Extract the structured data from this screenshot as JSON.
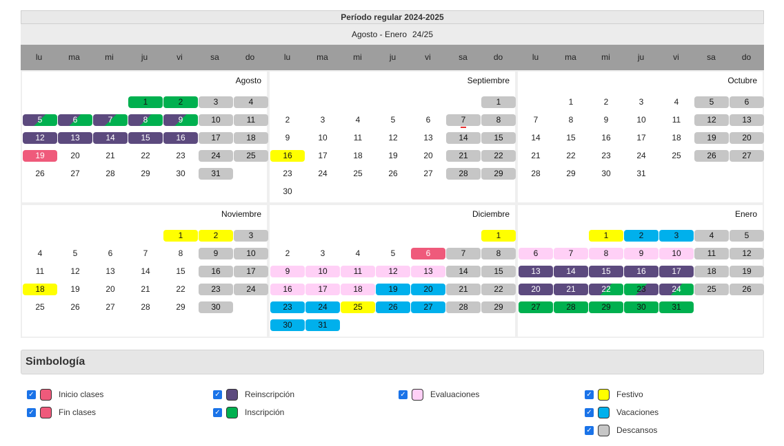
{
  "header": {
    "title": "Período regular 2024-2025",
    "subtitle": "Agosto - Enero",
    "period_code": "24/25"
  },
  "colors": {
    "inicio_fin": "#ef5a7b",
    "reinscripcion": "#5c4a7e",
    "inscripcion": "#00b04f",
    "evaluaciones": "#ffd0f6",
    "festivo": "#ffff00",
    "vacaciones": "#00b0ec",
    "descansos": "#c6c6c6"
  },
  "weekdays": [
    "lu",
    "ma",
    "mi",
    "ju",
    "vi",
    "sa",
    "do",
    "lu",
    "ma",
    "mi",
    "ju",
    "vi",
    "sa",
    "do",
    "lu",
    "ma",
    "mi",
    "ju",
    "vi",
    "sa",
    "do"
  ],
  "months": [
    {
      "name": "Agosto",
      "offset": 3,
      "days": 31,
      "today": 0,
      "marks": {
        "1": "inscripcion",
        "2": "inscripcion",
        "3": "descansos",
        "4": "descansos",
        "5": "reinscripcion+inscripcion",
        "6": "reinscripcion+inscripcion",
        "7": "reinscripcion+inscripcion",
        "8": "reinscripcion+inscripcion",
        "9": "reinscripcion+inscripcion",
        "10": "descansos",
        "11": "descansos",
        "12": "reinscripcion",
        "13": "reinscripcion",
        "14": "reinscripcion",
        "15": "reinscripcion",
        "16": "reinscripcion",
        "17": "descansos",
        "18": "descansos",
        "19": "inicio_fin",
        "24": "descansos",
        "25": "descansos",
        "31": "descansos"
      }
    },
    {
      "name": "Septiembre",
      "offset": 6,
      "days": 30,
      "today": 7,
      "marks": {
        "1": "descansos",
        "7": "descansos",
        "8": "descansos",
        "14": "descansos",
        "15": "descansos",
        "16": "festivo",
        "21": "descansos",
        "22": "descansos",
        "28": "descansos",
        "29": "descansos"
      }
    },
    {
      "name": "Octubre",
      "offset": 1,
      "days": 31,
      "today": 0,
      "marks": {
        "5": "descansos",
        "6": "descansos",
        "12": "descansos",
        "13": "descansos",
        "19": "descansos",
        "20": "descansos",
        "26": "descansos",
        "27": "descansos"
      }
    },
    {
      "name": "Noviembre",
      "offset": 4,
      "days": 30,
      "today": 0,
      "marks": {
        "1": "festivo",
        "2": "festivo",
        "3": "descansos",
        "9": "descansos",
        "10": "descansos",
        "16": "descansos",
        "17": "descansos",
        "18": "festivo",
        "23": "descansos",
        "24": "descansos",
        "30": "descansos"
      }
    },
    {
      "name": "Diciembre",
      "offset": 6,
      "days": 31,
      "today": 0,
      "marks": {
        "1": "festivo",
        "6": "inicio_fin",
        "7": "descansos",
        "8": "descansos",
        "9": "evaluaciones",
        "10": "evaluaciones",
        "11": "evaluaciones",
        "12": "evaluaciones",
        "13": "evaluaciones",
        "14": "descansos",
        "15": "descansos",
        "16": "evaluaciones",
        "17": "evaluaciones",
        "18": "evaluaciones",
        "19": "vacaciones",
        "20": "vacaciones",
        "21": "descansos",
        "22": "descansos",
        "23": "vacaciones",
        "24": "vacaciones",
        "25": "festivo",
        "26": "vacaciones",
        "27": "vacaciones",
        "28": "descansos",
        "29": "descansos",
        "30": "vacaciones",
        "31": "vacaciones"
      }
    },
    {
      "name": "Enero",
      "offset": 2,
      "days": 31,
      "today": 0,
      "marks": {
        "1": "festivo",
        "2": "vacaciones",
        "3": "vacaciones",
        "4": "descansos",
        "5": "descansos",
        "6": "evaluaciones",
        "7": "evaluaciones",
        "8": "evaluaciones",
        "9": "evaluaciones",
        "10": "evaluaciones",
        "11": "descansos",
        "12": "descansos",
        "13": "reinscripcion",
        "14": "reinscripcion",
        "15": "reinscripcion",
        "16": "reinscripcion",
        "17": "reinscripcion",
        "18": "descansos",
        "19": "descansos",
        "20": "reinscripcion",
        "21": "reinscripcion",
        "22": "reinscripcion+inscripcion",
        "23": "inscripcion+reinscripcion",
        "24": "reinscripcion+inscripcion",
        "25": "descansos",
        "26": "descansos",
        "27": "inscripcion",
        "28": "inscripcion",
        "29": "inscripcion",
        "30": "inscripcion",
        "31": "inscripcion"
      }
    }
  ],
  "legend": {
    "title": "Simbología",
    "items": [
      {
        "label": "Inicio clases",
        "color": "#ef5a7b",
        "checked": true
      },
      {
        "label": "Fin clases",
        "color": "#ef5a7b",
        "checked": true
      },
      {
        "label": "Reinscripción",
        "color": "#5c4a7e",
        "checked": true
      },
      {
        "label": "Inscripción",
        "color": "#00b04f",
        "checked": true
      },
      {
        "label": "Evaluaciones",
        "color": "#ffd0f6",
        "checked": true
      },
      {
        "label": "Festivo",
        "color": "#ffff00",
        "checked": true
      },
      {
        "label": "Vacaciones",
        "color": "#00b0ec",
        "checked": true
      },
      {
        "label": "Descansos",
        "color": "#c6c6c6",
        "checked": true
      }
    ]
  }
}
